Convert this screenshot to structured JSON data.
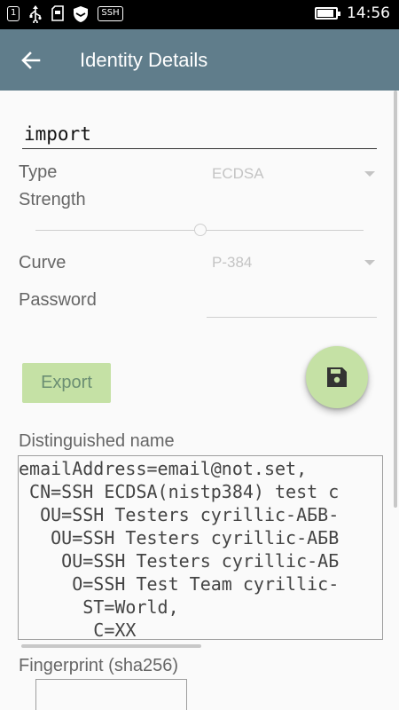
{
  "status_bar": {
    "icons": [
      "notification-1-icon",
      "usb-icon",
      "sd-card-icon",
      "shield-icon",
      "ssh-icon"
    ],
    "notification_text": "1",
    "ssh_badge": "SSH",
    "battery_level": 0.9,
    "time": "14:56"
  },
  "app_bar": {
    "title": "Identity Details",
    "back_icon": "arrow-back-icon",
    "color": "#607d8b"
  },
  "form": {
    "name_value": "import",
    "type_label": "Type",
    "type_value": "ECDSA",
    "strength_label": "Strength",
    "strength_level": 0.5,
    "curve_label": "Curve",
    "curve_value": "P-384",
    "password_label": "Password",
    "password_value": ""
  },
  "actions": {
    "export_label": "Export",
    "save_icon": "floppy-disk-icon",
    "accent": "#c5e1a5"
  },
  "distinguished_name": {
    "label": "Distinguished name",
    "lines": [
      "emailAddress=email@not.set,",
      " CN=SSH ECDSA(nistp384) test c",
      "  OU=SSH Testers cyrillic-АБВ-",
      "   OU=SSH Testers cyrillic-АБВ",
      "    OU=SSH Testers cyrillic-АБ",
      "     O=SSH Test Team cyrillic-",
      "      ST=World,",
      "       C=XX"
    ]
  },
  "fingerprint": {
    "label": "Fingerprint (sha256)"
  }
}
